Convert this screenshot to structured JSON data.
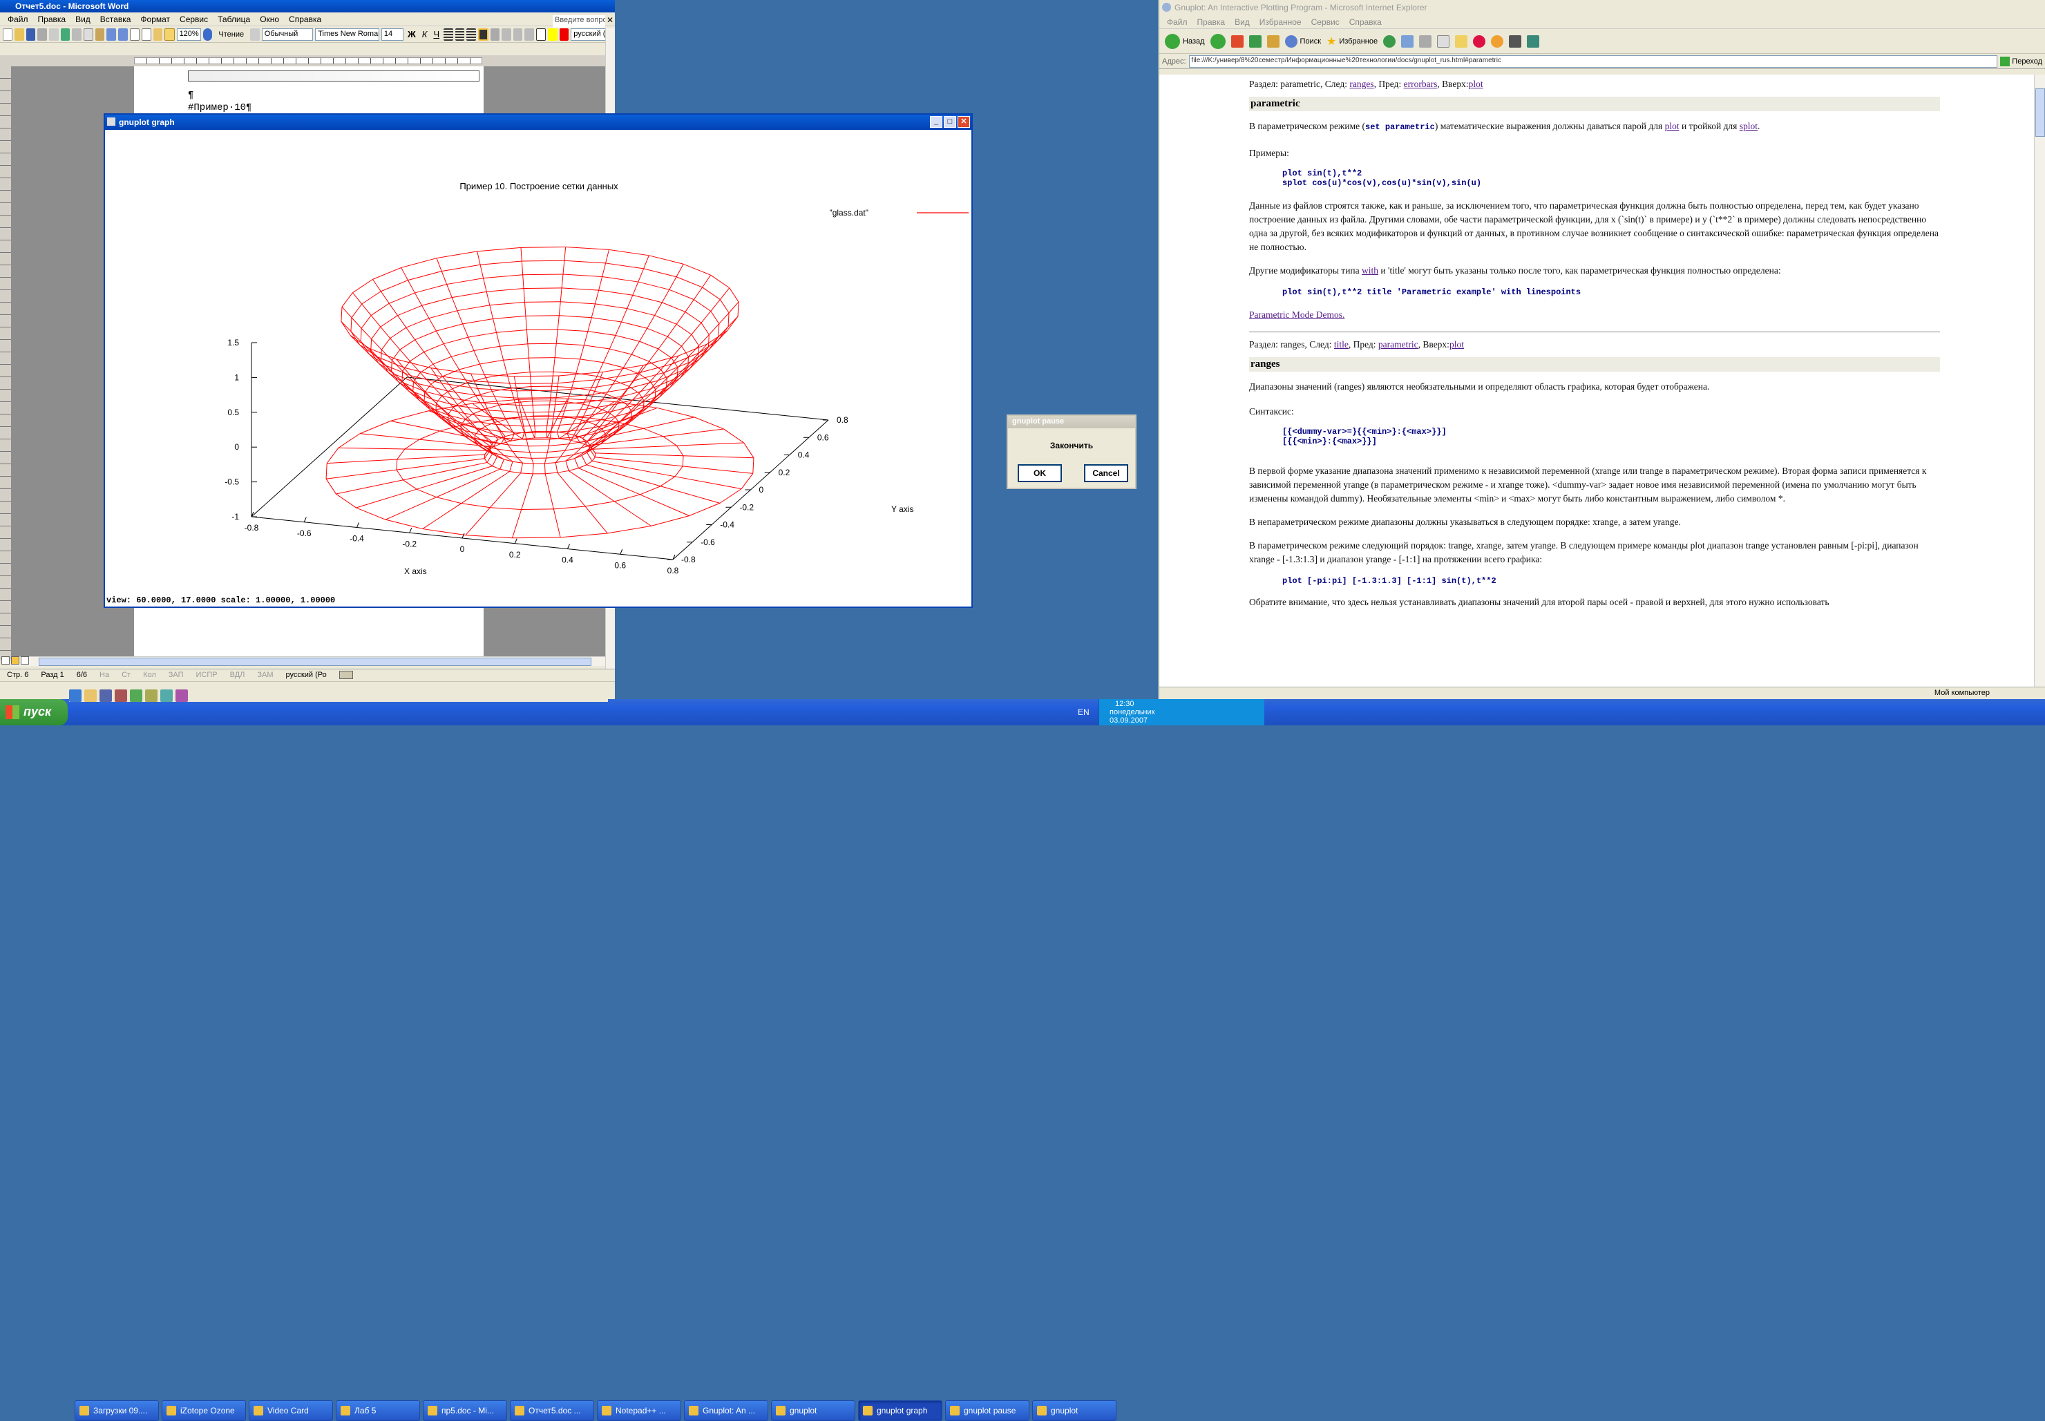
{
  "word": {
    "title": "Отчет5.doc - Microsoft Word",
    "menu": [
      "Файл",
      "Правка",
      "Вид",
      "Вставка",
      "Формат",
      "Сервис",
      "Таблица",
      "Окно",
      "Справка"
    ],
    "help_placeholder": "Введите вопрос",
    "zoom": "120%",
    "view_mode": "Чтение",
    "style": "Обычный",
    "font": "Times New Roman",
    "size": "14",
    "language": "русский (Росс",
    "doc_lines": [
      "¶",
      "#Пример·10¶"
    ],
    "status": {
      "page": "Стр. 6",
      "section": "Разд 1",
      "pages": "6/6",
      "at": "На",
      "line": "Ст",
      "col": "Кол",
      "rec": "ЗАП",
      "trk": "ИСПР",
      "ext": "ВДЛ",
      "ovr": "ЗАМ",
      "lang": "русский (Ро"
    }
  },
  "gnuplot": {
    "title": "gnuplot graph",
    "plot_title": "Пример 10. Построение сетки данных",
    "legend": "\"glass.dat\"",
    "legend_color": "#ff0000",
    "z_ticks": [
      "1.5",
      "1",
      "0.5",
      "0",
      "-0.5",
      "-1"
    ],
    "x_ticks": [
      "-0.8",
      "-0.6",
      "-0.4",
      "-0.2",
      "0",
      "0.2",
      "0.4",
      "0.6",
      "0.8"
    ],
    "y_ticks": [
      "0.8",
      "0.6",
      "0.4",
      "0.2",
      "0",
      "-0.2",
      "-0.4",
      "-0.6",
      "-0.8"
    ],
    "x_label": "X axis",
    "y_label": "Y axis",
    "status": "view: 60.0000,  17.0000   scale: 1.00000,  1.00000"
  },
  "pause_dialog": {
    "title": "gnuplot pause",
    "message": "Закончить",
    "ok": "OK",
    "cancel": "Cancel"
  },
  "ie": {
    "title": "Gnuplot: An Interactive Plotting Program - Microsoft Internet Explorer",
    "menu": [
      "Файл",
      "Правка",
      "Вид",
      "Избранное",
      "Сервис",
      "Справка"
    ],
    "back": "Назад",
    "search": "Поиск",
    "favorites": "Избранное",
    "address_label": "Адрес:",
    "address": "file:///K:/универ/8%20семестр/Информационные%20технологии/docs/gnuplot_rus.html#parametric",
    "go": "Переход",
    "nav1": {
      "prefix": "Раздел: parametric, След: ",
      "next": "ranges",
      ", Пред: ": "",
      "sep1": ", Пред: ",
      "prev": "errorbars",
      "sep2": ", Вверх:",
      "up": "plot"
    },
    "section1": "parametric",
    "p1": {
      "a": "В параметрическом режиме (",
      "code": "set parametric",
      "b": ") математические выражения должны даваться парой для ",
      "l1": "plot",
      "c": " и тройкой для ",
      "l2": "splot",
      "d": "."
    },
    "examples_label": "Примеры:",
    "code1": [
      "plot sin(t),t**2",
      "splot cos(u)*cos(v),cos(u)*sin(v),sin(u)"
    ],
    "p2": "Данные из файлов строятся также, как и раньше, за исключением того, что параметрическая функция должна быть полностью определена, перед тем, как будет указано построение данных из файла. Другими словами, обе части параметрической функции, для x (`sin(t)` в примере) и y (`t**2` в примере) должны следовать непосредственно одна за другой, без всяких модификаторов и функций от данных, в противном случае возникнет сообщение о синтаксической ошибке: параметрическая функция определена не полностью.",
    "p3": {
      "a": "Другие модификаторы типа ",
      "l": "with",
      "b": " и 'title' могут быть указаны только после того, как параметрическая функция полностью определена:"
    },
    "code2": "plot sin(t),t**2 title 'Parametric example' with linespoints",
    "demo_link": "Parametric Mode Demos.",
    "nav2": {
      "prefix": "Раздел: ranges, След: ",
      "next": "title",
      "sep1": ", Пред: ",
      "prev": "parametric",
      "sep2": ", Вверх:",
      "up": "plot"
    },
    "section2": "ranges",
    "p4": "Диапазоны значений (ranges) являются необязательными и определяют область графика, которая будет отображена.",
    "syntax_label": "Синтаксис:",
    "code3": [
      "[{<dummy-var>=}{{<min>}:{<max>}}]",
      "[{{<min>}:{<max>}}]"
    ],
    "p5": "В первой форме указание диапазона значений применимо к независимой переменной (xrange или trange в параметрическом режиме). Вторая форма записи применяется к зависимой переменной yrange (в параметрическом режиме - и xrange тоже). <dummy-var> задает новое имя независимой переменной (имена по умолчанию могут быть изменены командой dummy). Необязательные элементы <min> и <max> могут быть либо константным выражением, либо символом *.",
    "p6": "В непараметрическом режиме диапазоны должны указываться в следующем порядке: xrange, а затем yrange.",
    "p7": "В параметрическом режиме следующий порядок: trange, xrange, затем yrange. В следующем примере команды plot диапазон trange установлен равным [-pi:pi], диапазон xrange - [-1.3:1.3] и диапазон yrange - [-1:1] на протяжении всего графика:",
    "code4": "plot [-pi:pi] [-1.3:1.3] [-1:1] sin(t),t**2",
    "p8": "Обратите внимание, что здесь нельзя устанавливать диапазоны значений для второй пары осей - правой и верхней, для этого нужно использовать",
    "status": "Мой компьютер"
  },
  "taskbar": {
    "start": "пуск",
    "items": [
      "Загрузки 09....",
      "iZotope Ozone",
      "Video Card",
      "Лаб 5",
      "пр5.doc - Mi...",
      "Отчет5.doc ...",
      "Notepad++ ...",
      "Gnuplot: An ...",
      "gnuplot",
      "gnuplot graph",
      "gnuplot pause",
      "gnuplot"
    ],
    "active_index": 9,
    "lang": "EN",
    "time": "12:30",
    "day": "понедельник",
    "date": "03.09.2007"
  }
}
